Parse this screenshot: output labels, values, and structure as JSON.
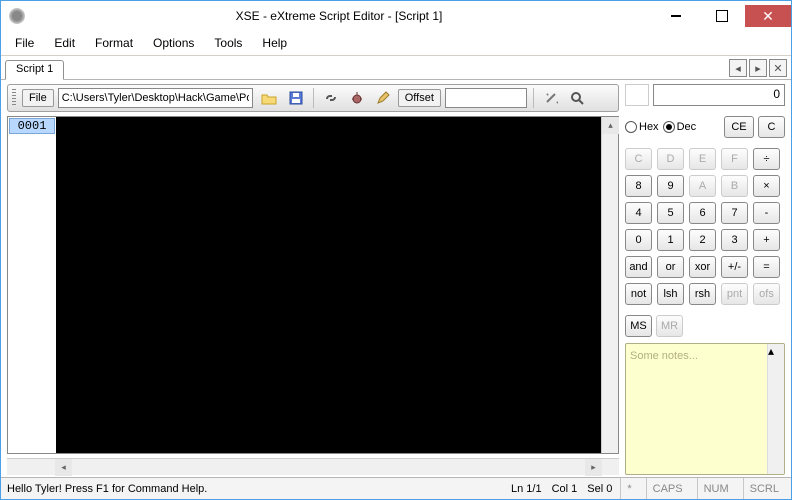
{
  "window": {
    "title": "XSE - eXtreme Script Editor - [Script 1]"
  },
  "menu": {
    "file": "File",
    "edit": "Edit",
    "format": "Format",
    "options": "Options",
    "tools": "Tools",
    "help": "Help"
  },
  "tabs": {
    "active": "Script 1"
  },
  "toolbar": {
    "file_label": "File",
    "path": "C:\\Users\\Tyler\\Desktop\\Hack\\Game\\Poke",
    "offset_label": "Offset",
    "offset_value": ""
  },
  "editor": {
    "first_line_no": "0001"
  },
  "calc": {
    "display": "0",
    "mode_hex": "Hex",
    "mode_dec": "Dec",
    "ce": "CE",
    "c": "C",
    "keys": [
      {
        "l": "C",
        "d": true
      },
      {
        "l": "D",
        "d": true
      },
      {
        "l": "E",
        "d": true
      },
      {
        "l": "F",
        "d": true
      },
      {
        "l": "÷",
        "d": false
      },
      {
        "l": "8",
        "d": false
      },
      {
        "l": "9",
        "d": false
      },
      {
        "l": "A",
        "d": true
      },
      {
        "l": "B",
        "d": true
      },
      {
        "l": "×",
        "d": false
      },
      {
        "l": "4",
        "d": false
      },
      {
        "l": "5",
        "d": false
      },
      {
        "l": "6",
        "d": false
      },
      {
        "l": "7",
        "d": false
      },
      {
        "l": "-",
        "d": false
      },
      {
        "l": "0",
        "d": false
      },
      {
        "l": "1",
        "d": false
      },
      {
        "l": "2",
        "d": false
      },
      {
        "l": "3",
        "d": false
      },
      {
        "l": "+",
        "d": false
      },
      {
        "l": "and",
        "d": false
      },
      {
        "l": "or",
        "d": false
      },
      {
        "l": "xor",
        "d": false
      },
      {
        "l": "+/-",
        "d": false
      },
      {
        "l": "=",
        "d": false
      },
      {
        "l": "not",
        "d": false
      },
      {
        "l": "lsh",
        "d": false
      },
      {
        "l": "rsh",
        "d": false
      },
      {
        "l": "pnt",
        "d": true
      },
      {
        "l": "ofs",
        "d": true
      }
    ],
    "ms": "MS",
    "mr": "MR"
  },
  "notes": {
    "placeholder": "Some notes..."
  },
  "status": {
    "message": "Hello Tyler! Press F1 for Command Help.",
    "line": "Ln 1/1",
    "col": "Col 1",
    "sel": "Sel 0",
    "star": "*",
    "caps": "CAPS",
    "num": "NUM",
    "scrl": "SCRL"
  }
}
